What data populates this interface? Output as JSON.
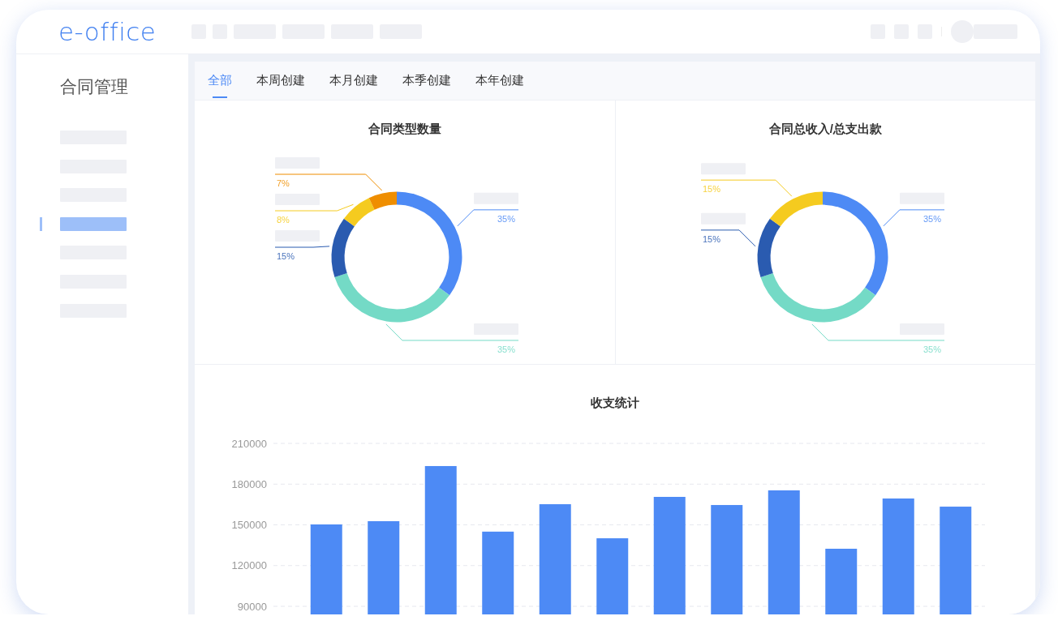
{
  "header": {
    "logo": "e-office"
  },
  "sidebar": {
    "title": "合同管理",
    "items": [
      {
        "selected": false
      },
      {
        "selected": false
      },
      {
        "selected": false
      },
      {
        "selected": true
      },
      {
        "selected": false
      },
      {
        "selected": false
      },
      {
        "selected": false
      }
    ]
  },
  "tabs": [
    {
      "label": "全部",
      "selected": true
    },
    {
      "label": "本周创建",
      "selected": false
    },
    {
      "label": "本月创建",
      "selected": false
    },
    {
      "label": "本季创建",
      "selected": false
    },
    {
      "label": "本年创建",
      "selected": false
    }
  ],
  "donut_charts": [
    {
      "title": "合同类型数量",
      "chart_data": {
        "type": "donut",
        "values": [
          35,
          35,
          15,
          8,
          7
        ],
        "value_labels": [
          "35%",
          "35%",
          "15%",
          "8%",
          "7%"
        ],
        "colors": [
          "#4d8af5",
          "#74dac6",
          "#2a5bb0",
          "#f5cb1f",
          "#ef8e00"
        ]
      }
    },
    {
      "title": "合同总收入/总支出款",
      "chart_data": {
        "type": "donut",
        "values": [
          35,
          35,
          15,
          15
        ],
        "value_labels": [
          "35%",
          "35%",
          "15%",
          "15%"
        ],
        "colors": [
          "#4d8af5",
          "#74dac6",
          "#2a5bb0",
          "#f5cb1f"
        ]
      }
    }
  ],
  "bar_chart": {
    "title": "收支统计",
    "chart_data": {
      "type": "bar",
      "values": [
        150300,
        152700,
        193300,
        145000,
        165200,
        140100,
        170600,
        164600,
        175400,
        132400,
        169400,
        163400
      ],
      "ylim": [
        90000,
        210000
      ],
      "grid": true,
      "yticks": [
        90000,
        120000,
        150000,
        180000,
        210000
      ],
      "color": "#4d8af5"
    }
  }
}
